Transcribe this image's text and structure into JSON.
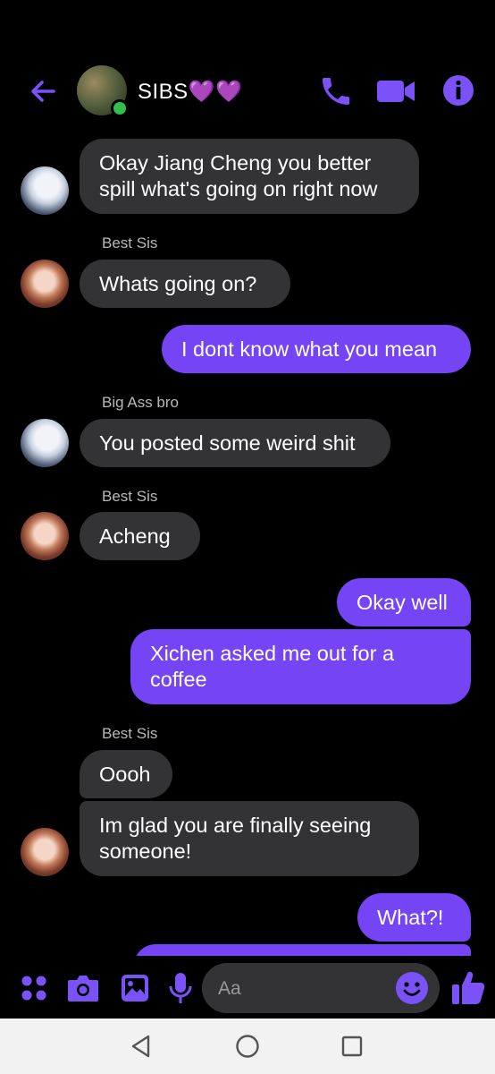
{
  "header": {
    "title": "SIBS💜💜",
    "accent": "#7444f5"
  },
  "messages": {
    "m1": "Okay Jiang Cheng you better spill what's going on right now",
    "s1": "Best Sis",
    "m2": "Whats going on?",
    "m3": "I dont know what you mean",
    "s2": "Big Ass bro",
    "m4": "You posted some weird shit",
    "s3": "Best Sis",
    "m5": "Acheng",
    "m6": "Okay well",
    "m7": "Xichen asked me out for a coffee",
    "s4": "Best Sis",
    "m8": "Oooh",
    "m9": "Im glad you are finally seeing someone!",
    "m10": "What?!"
  },
  "composer": {
    "placeholder": "Aa"
  },
  "icons": {
    "back": "back-arrow-icon",
    "call": "phone-icon",
    "video": "video-camera-icon",
    "info": "info-icon",
    "apps": "apps-grid-icon",
    "camera": "camera-icon",
    "gallery": "image-icon",
    "mic": "microphone-icon",
    "emoji": "emoji-icon",
    "like": "thumbs-up-icon"
  }
}
